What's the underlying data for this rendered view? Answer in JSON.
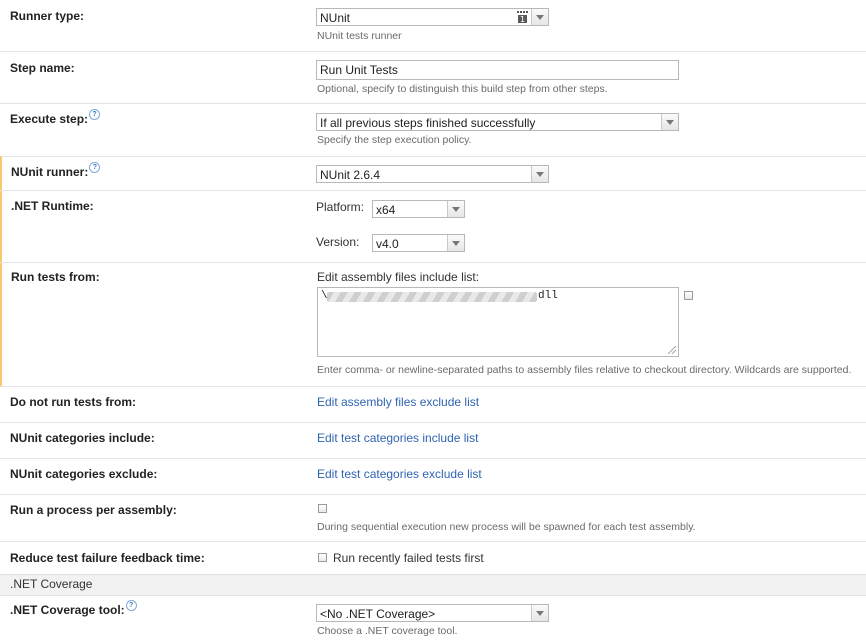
{
  "runner_type": {
    "label": "Runner type:",
    "value": "NUnit",
    "hint": "NUnit tests runner"
  },
  "step_name": {
    "label": "Step name:",
    "value": "Run Unit Tests",
    "hint": "Optional, specify to distinguish this build step from other steps."
  },
  "execute_step": {
    "label": "Execute step:",
    "value": "If all previous steps finished successfully",
    "hint": "Specify the step execution policy."
  },
  "nunit_runner": {
    "label": "NUnit runner:",
    "value": "NUnit 2.6.4"
  },
  "net_runtime": {
    "label": ".NET Runtime:",
    "platform_label": "Platform:",
    "platform_value": "x64",
    "version_label": "Version:",
    "version_value": "v4.0"
  },
  "run_tests_from": {
    "label": "Run tests from:",
    "edit_label": "Edit assembly files include list:",
    "path_suffix": "dll",
    "hint": "Enter comma- or newline-separated paths to assembly files relative to checkout directory. Wildcards are supported."
  },
  "do_not_run": {
    "label": "Do not run tests from:",
    "link": "Edit assembly files exclude list"
  },
  "categories_include": {
    "label": "NUnit categories include:",
    "link": "Edit test categories include list"
  },
  "categories_exclude": {
    "label": "NUnit categories exclude:",
    "link": "Edit test categories exclude list"
  },
  "process_per_assembly": {
    "label": "Run a process per assembly:",
    "hint": "During sequential execution new process will be spawned for each test assembly."
  },
  "reduce_feedback": {
    "label": "Reduce test failure feedback time:",
    "checkbox_label": "Run recently failed tests first"
  },
  "coverage_section": {
    "title": ".NET Coverage"
  },
  "coverage_tool": {
    "label": ".NET Coverage tool:",
    "value": "<No .NET Coverage>",
    "hint": "Choose a .NET coverage tool."
  },
  "help_glyph": "?",
  "icons": {
    "help": "question-circle-icon",
    "runner_icon": "nunit-runner-icon",
    "dropdown": "chevron-down-icon"
  }
}
